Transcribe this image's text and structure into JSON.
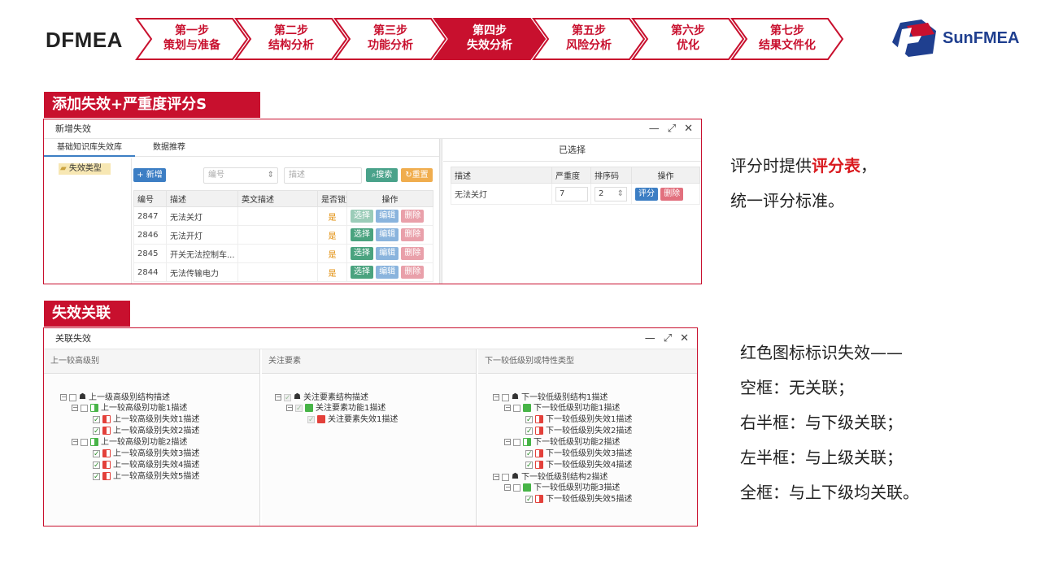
{
  "brand": "DFMEA",
  "steps": [
    {
      "line1": "第一步",
      "line2": "策划与准备"
    },
    {
      "line1": "第二步",
      "line2": "结构分析"
    },
    {
      "line1": "第三步",
      "line2": "功能分析"
    },
    {
      "line1": "第四步",
      "line2": "失效分析"
    },
    {
      "line1": "第五步",
      "line2": "风险分析"
    },
    {
      "line1": "第六步",
      "line2": "优化"
    },
    {
      "line1": "第七步",
      "line2": "结果文件化"
    }
  ],
  "logo_text": "SunFMEA",
  "colors": {
    "accent": "#c8102e",
    "brand_blue": "#1f3f8f"
  },
  "section1": {
    "title": "添加失效+严重度评分S",
    "window_title": "新增失效",
    "tab_left": "基础知识库失效库",
    "tab_right": "数据推荐",
    "tree_root": "失效类型",
    "new_button": "+ 新增",
    "code_placeholder": "编号",
    "desc_placeholder": "描述",
    "search_button": "搜索",
    "reset_button": "重置",
    "columns": [
      "编号",
      "描述",
      "英文描述",
      "是否锁定",
      "操作"
    ],
    "rows": [
      {
        "code": "2847",
        "desc": "无法关灯",
        "en": "",
        "locked": "是"
      },
      {
        "code": "2846",
        "desc": "无法开灯",
        "en": "",
        "locked": "是"
      },
      {
        "code": "2845",
        "desc": "开关无法控制车...",
        "en": "",
        "locked": "是"
      },
      {
        "code": "2844",
        "desc": "无法传输电力",
        "en": "",
        "locked": "是"
      }
    ],
    "row_actions": {
      "select": "选择",
      "edit": "编辑",
      "delete": "删除"
    },
    "selected_title": "已选择",
    "selected_columns": [
      "描述",
      "严重度",
      "排序码",
      "操作"
    ],
    "selected_row": {
      "desc": "无法关灯",
      "severity": "7",
      "order": "2",
      "rate": "评分",
      "delete": "删除"
    }
  },
  "section2": {
    "title": "失效关联",
    "window_title": "关联失效",
    "col_upper": "上一较高级别",
    "col_focus": "关注要素",
    "col_lower": "下一较低级别或特性类型",
    "upper_tree": [
      "上一级高级别结构描述",
      "上一较高级别功能1描述",
      "上一较高级别失效1描述",
      "上一较高级别失效2描述",
      "上一较高级别功能2描述",
      "上一较高级别失效3描述",
      "上一较高级别失效4描述",
      "上一较高级别失效5描述"
    ],
    "focus_tree": [
      "关注要素结构描述",
      "关注要素功能1描述",
      "关注要素失效1描述"
    ],
    "lower_tree": [
      "下一较低级别结构1描述",
      "下一较低级别功能1描述",
      "下一较低级别失效1描述",
      "下一较低级别失效2描述",
      "下一较低级别功能2描述",
      "下一较低级别失效3描述",
      "下一较低级别失效4描述",
      "下一较低级别结构2描述",
      "下一较低级别功能3描述",
      "下一较低级别失效5描述"
    ]
  },
  "notes1": {
    "line1_a": "评分时提供",
    "line1_hl": "评分表",
    "line1_b": "，",
    "line2": "统一评分标准。"
  },
  "notes2": [
    "红色图标标识失效——",
    "空框：无关联；",
    "右半框：与下级关联；",
    "左半框：与上级关联；",
    "全框：与上下级均关联。"
  ]
}
